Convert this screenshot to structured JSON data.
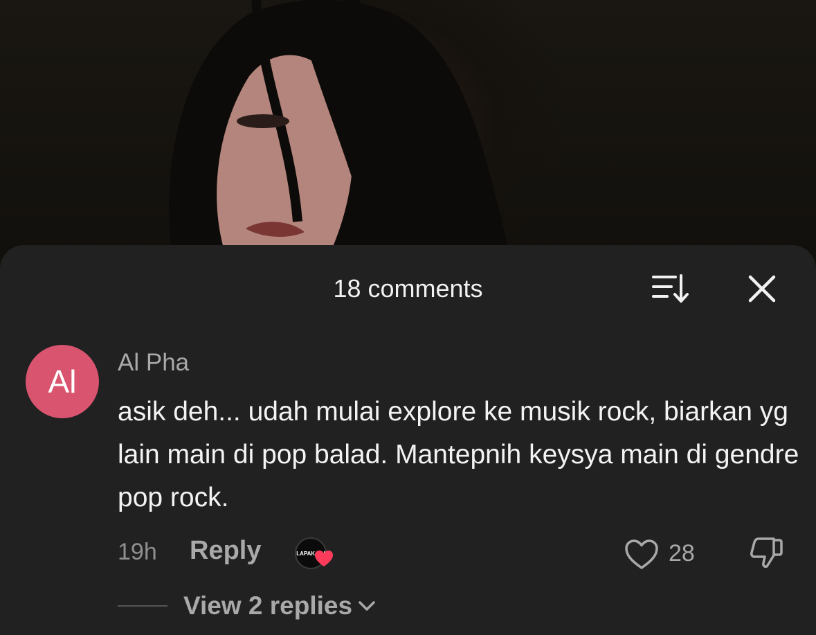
{
  "comments_sheet": {
    "title": "18 comments",
    "sort_icon": "sort-down-icon",
    "close_icon": "close-icon"
  },
  "comment": {
    "avatar_initials": "Al",
    "avatar_color": "#d8546f",
    "username": "Al Pha",
    "text": "asik deh... udah mulai explore ke musik rock, biarkan yg lain main di pop balad. Mantepnih keysya main di gendre pop rock.",
    "time": "19h",
    "reply_label": "Reply",
    "creator_badge_text": "LAPAK MU",
    "like_count": "28",
    "view_replies_label": "View 2 replies"
  },
  "colors": {
    "sheet_background": "#212121",
    "heart_red": "#ff3b5c"
  }
}
